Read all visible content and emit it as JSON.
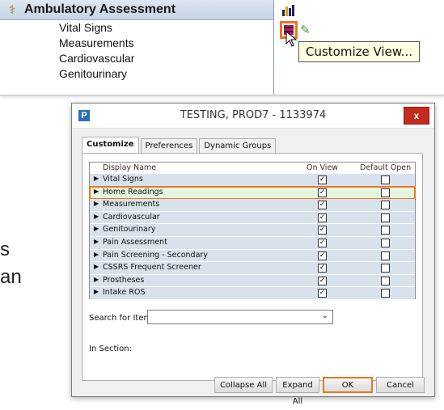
{
  "band_list": {
    "header_title": "Ambulatory Assessment",
    "items": [
      "Vital Signs",
      "Measurements",
      "Cardiovascular",
      "Genitourinary"
    ]
  },
  "toolbar": {
    "tooltip": "Customize View..."
  },
  "background_fragments": [
    "s",
    "an"
  ],
  "dialog": {
    "title": "TESTING, PROD7 - 1133974",
    "close_label": "x",
    "app_icon_letter": "P",
    "tabs": [
      "Customize",
      "Preferences",
      "Dynamic Groups"
    ],
    "active_tab": "Customize",
    "columns": [
      "Display Name",
      "On View",
      "Default Open"
    ],
    "rows": [
      {
        "name": "Vital Signs",
        "on_view": true,
        "default_open": false
      },
      {
        "name": "Home Readings",
        "on_view": true,
        "default_open": false,
        "highlighted": true
      },
      {
        "name": "Measurements",
        "on_view": true,
        "default_open": false
      },
      {
        "name": "Cardiovascular",
        "on_view": true,
        "default_open": false
      },
      {
        "name": "Genitourinary",
        "on_view": true,
        "default_open": false
      },
      {
        "name": "Pain Assessment",
        "on_view": true,
        "default_open": false
      },
      {
        "name": "Pain Screening - Secondary",
        "on_view": true,
        "default_open": false
      },
      {
        "name": "CSSRS Frequent Screener",
        "on_view": true,
        "default_open": false
      },
      {
        "name": "Prostheses",
        "on_view": true,
        "default_open": false
      },
      {
        "name": "Intake ROS",
        "on_view": true,
        "default_open": false
      }
    ],
    "search_label": "Search for Item:",
    "search_value": "",
    "section_label": "In Section:",
    "buttons": {
      "collapse_all": "Collapse All",
      "expand_all": "Expand All",
      "ok": "OK",
      "cancel": "Cancel"
    }
  },
  "colors": {
    "highlight_orange": "#e87722",
    "row_blue": "#d9e2ec",
    "row_green": "#e6f5dd",
    "tooltip_bg": "#ffffe1",
    "close_red": "#c42b1c"
  }
}
